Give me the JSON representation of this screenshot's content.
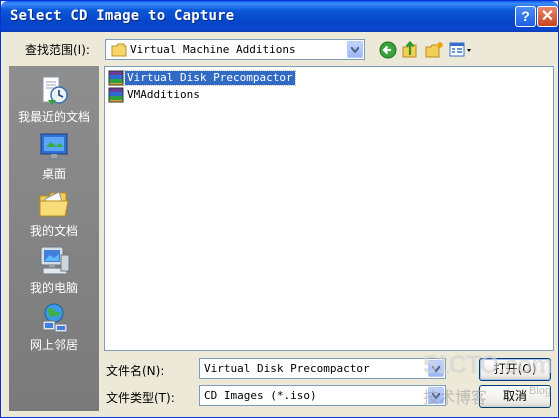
{
  "window": {
    "title": "Select CD Image to Capture"
  },
  "titlebar_buttons": {
    "help": "?",
    "close": "✕"
  },
  "lookin": {
    "label": "查找范围(I):",
    "value": "Virtual Machine Additions"
  },
  "toolbar": {
    "icons": [
      "back-icon",
      "up-folder-icon",
      "new-folder-icon",
      "view-menu-icon"
    ]
  },
  "places": [
    {
      "label": "我最近的文档",
      "icon": "recent-documents-icon"
    },
    {
      "label": "桌面",
      "icon": "desktop-icon"
    },
    {
      "label": "我的文档",
      "icon": "my-documents-icon"
    },
    {
      "label": "我的电脑",
      "icon": "my-computer-icon"
    },
    {
      "label": "网上邻居",
      "icon": "network-places-icon"
    }
  ],
  "files": [
    {
      "name": "Virtual Disk Precompactor",
      "selected": true,
      "icon": "disk-image-icon"
    },
    {
      "name": "VMAdditions",
      "selected": false,
      "icon": "disk-image-icon"
    }
  ],
  "filename": {
    "label": "文件名(N):",
    "value": "Virtual Disk Precompactor"
  },
  "filetype": {
    "label": "文件类型(T):",
    "value": "CD Images (*.iso)"
  },
  "buttons": {
    "open": "打开(O)",
    "cancel": "取消"
  },
  "watermark": {
    "main": "51CTO.com",
    "sub": "技术博客",
    "tag": "Blog"
  },
  "colors": {
    "titlebar": "#0a58d8",
    "dialog_bg": "#ece9d8",
    "places_bar": "#808080",
    "selection": "#316ac5"
  }
}
